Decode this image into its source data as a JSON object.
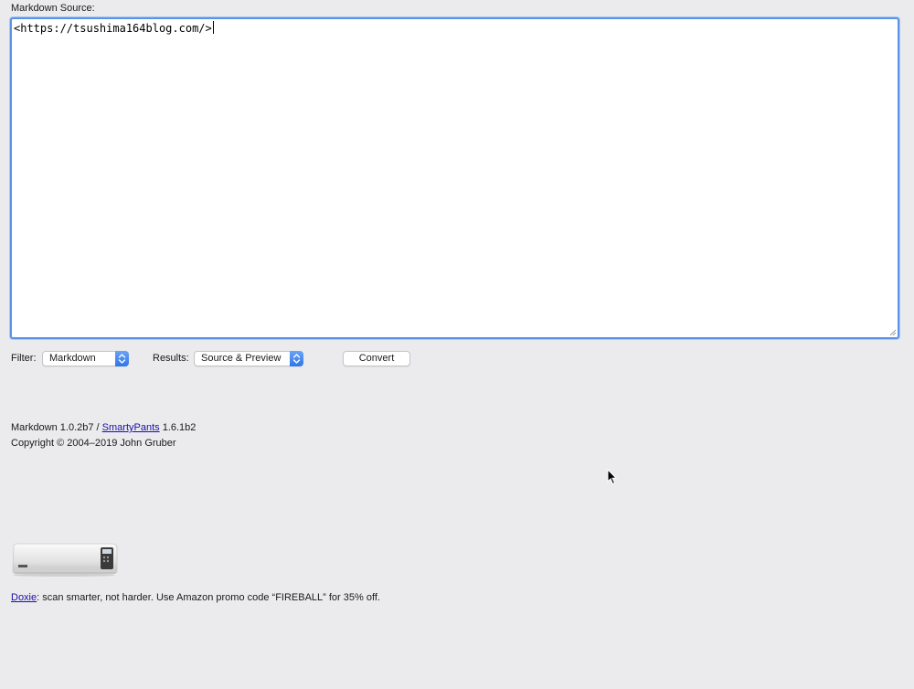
{
  "form": {
    "source_label": "Markdown Source:",
    "source_value": "<https://tsushima164blog.com/>"
  },
  "controls": {
    "filter_label": "Filter:",
    "filter_value": "Markdown",
    "results_label": "Results:",
    "results_value": "Source & Preview",
    "convert_label": "Convert"
  },
  "footer": {
    "version_prefix": "Markdown 1.0.2b7 / ",
    "smartypants_link": "SmartyPants",
    "version_suffix": " 1.6.1b2",
    "copyright": "Copyright © 2004–2019 John Gruber"
  },
  "sponsor": {
    "icon": "scanner-image",
    "link_text": "Doxie",
    "message": ": scan smarter, not harder. Use Amazon promo code “FIREBALL” for 35% off."
  },
  "colors": {
    "background": "#ebebed",
    "focus_ring": "#5b93e8",
    "link": "#1a0dab",
    "select_accent": "#2f75e8"
  }
}
